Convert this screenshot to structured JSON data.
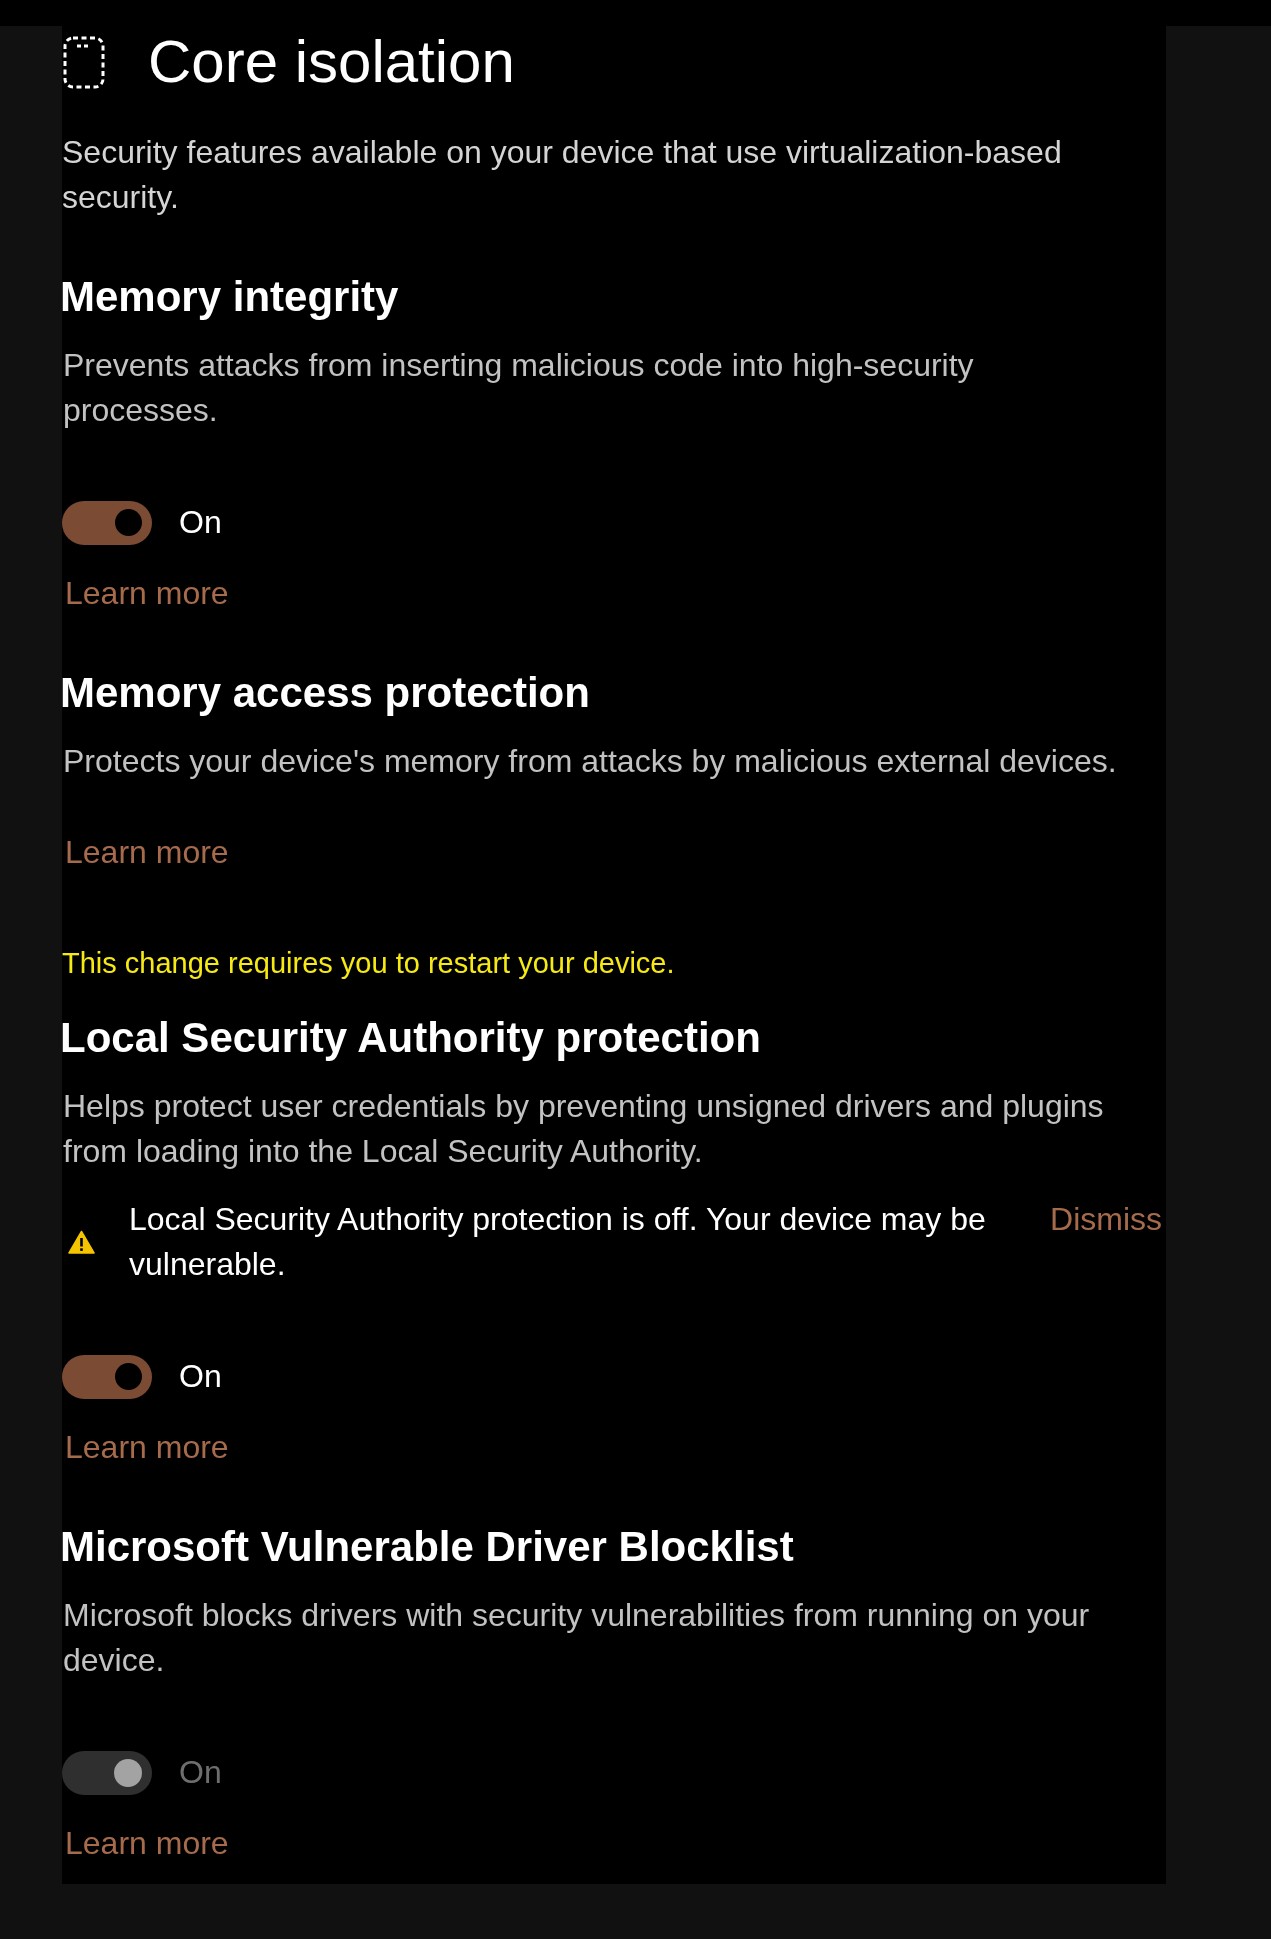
{
  "header": {
    "title": "Core isolation",
    "intro": "Security features available on your device that use virtualization-based security."
  },
  "sections": [
    {
      "heading": "Memory integrity",
      "description": "Prevents attacks from inserting malicious code into high-security processes.",
      "toggle": {
        "on": true,
        "disabled": false,
        "label": "On"
      },
      "link": "Learn more"
    },
    {
      "heading": "Memory access protection",
      "description": "Protects your device's memory from attacks by malicious external devices.",
      "link": "Learn more"
    },
    {
      "notice": "This change requires you to restart your device.",
      "heading": "Local Security Authority protection",
      "description": "Helps protect user credentials by preventing unsigned drivers and plugins from loading into the Local Security Authority.",
      "warning": {
        "message": "Local Security Authority protection is off. Your device may be vulnerable.",
        "action": "Dismiss"
      },
      "toggle": {
        "on": true,
        "disabled": false,
        "label": "On"
      },
      "link": "Learn more"
    },
    {
      "heading": "Microsoft Vulnerable Driver Blocklist",
      "description": "Microsoft blocks drivers with security vulnerabilities from running on your device.",
      "toggle": {
        "on": true,
        "disabled": true,
        "label": "On"
      },
      "link": "Learn more"
    }
  ]
}
